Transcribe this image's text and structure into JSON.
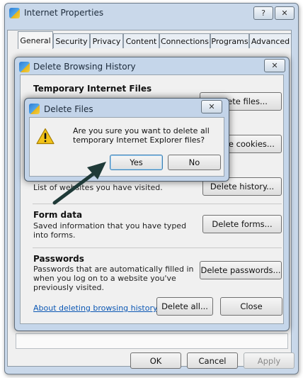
{
  "main_window": {
    "title": "Internet Properties",
    "help_glyph": "?",
    "close_glyph": "✕",
    "tabs": [
      {
        "label": "General"
      },
      {
        "label": "Security"
      },
      {
        "label": "Privacy"
      },
      {
        "label": "Content"
      },
      {
        "label": "Connections"
      },
      {
        "label": "Programs"
      },
      {
        "label": "Advanced"
      }
    ],
    "active_tab": "General",
    "buttons": {
      "ok": "OK",
      "cancel": "Cancel",
      "apply": "Apply"
    }
  },
  "delete_history_dialog": {
    "title": "Delete Browsing History",
    "close_glyph": "✕",
    "sections": {
      "temp_files": {
        "title": "Temporary Internet Files",
        "button": "Delete files..."
      },
      "cookies": {
        "button": "Delete cookies..."
      },
      "history": {
        "desc": "List of websites you have visited.",
        "button": "Delete history..."
      },
      "form_data": {
        "title": "Form data",
        "desc": "Saved information that you have typed into forms.",
        "button": "Delete forms..."
      },
      "passwords": {
        "title": "Passwords",
        "desc": "Passwords that are automatically filled in when you log on to a website you've previously visited.",
        "button": "Delete passwords..."
      }
    },
    "link": "About deleting browsing history",
    "delete_all": "Delete all...",
    "close": "Close"
  },
  "delete_files_dialog": {
    "title": "Delete Files",
    "close_glyph": "✕",
    "message": "Are you sure you want to delete all temporary Internet Explorer files?",
    "yes": "Yes",
    "no": "No"
  },
  "colors": {
    "link": "#0b57b4",
    "arrow": "#1f3a38",
    "warning": "#f2c318"
  },
  "icons": [
    "internet-options-icon",
    "warning-icon",
    "help-icon",
    "close-icon"
  ]
}
